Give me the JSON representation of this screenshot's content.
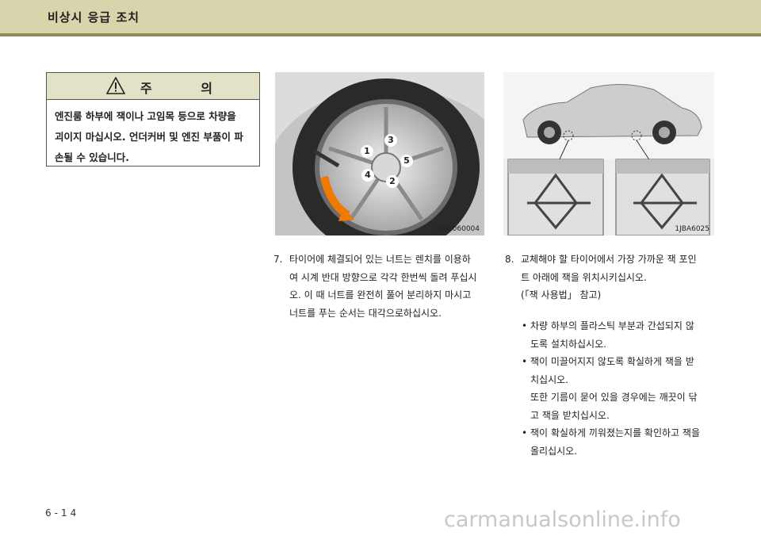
{
  "header": {
    "title": "비상시 응급 조치"
  },
  "caution": {
    "title": "주 의",
    "icon": "warning-triangle-icon",
    "lines": [
      "엔진룸 하부에 잭이나 고임목 등으로 차량을",
      "괴이지 마십시오. 언더커버 및 엔진 부품이 파",
      "손될 수 있습니다."
    ]
  },
  "figure1": {
    "label": "OHG060004",
    "nut_numbers": [
      "1",
      "2",
      "3",
      "4",
      "5"
    ]
  },
  "figure2": {
    "label": "1JBA6025"
  },
  "step7": {
    "number": "7.",
    "lines": [
      "타이어에 체결되어 있는 너트는 렌치를 이용하",
      "여 시계 반대 방향으로 각각 한번씩 돌려 푸십시",
      "오.   이 때 너트를 완전히 풀어 분리하지 마시고",
      "너트를 푸는 순서는 대각으로하십시오."
    ]
  },
  "step8": {
    "number": "8.",
    "lines": [
      "교체해야 할 타이어에서 가장 가까운 잭 포인",
      "트 아래에 잭을 위치시키십시오.",
      "(「잭 사용법」 참고)"
    ]
  },
  "bullets": [
    {
      "lines": [
        "차량 하부의 플라스틱 부분과 간섭되지 않",
        "도록 설치하십시오."
      ]
    },
    {
      "lines": [
        "잭이 미끌어지지 않도록 확실하게 잭을 받",
        "치십시오.",
        "또한 기름이 묻어 있을 경우에는 깨끗이 닦",
        "고 잭을 받치십시오."
      ]
    },
    {
      "lines": [
        "잭이 확실하게 끼워졌는지를 확인하고 잭을",
        "올리십시오."
      ]
    }
  ],
  "page_number": "6-14",
  "watermark": "carmanualsonline.info"
}
